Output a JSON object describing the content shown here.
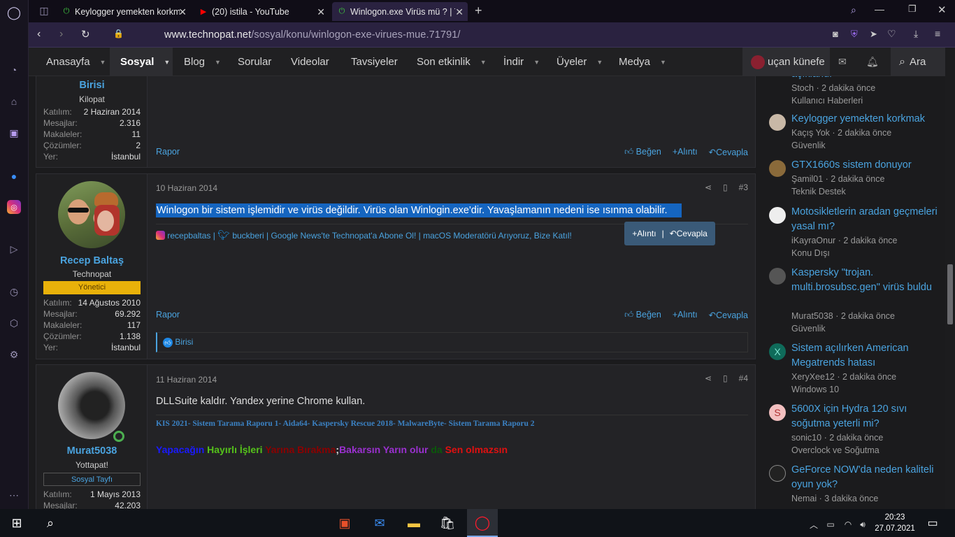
{
  "browser": {
    "tabs": [
      {
        "title": "Keylogger yemekten korkm"
      },
      {
        "title": "(20) istila - YouTube"
      },
      {
        "title": "Winlogon.exe Virüs mü ? | T"
      }
    ],
    "url_host": "www.technopat.net",
    "url_path": "/sosyal/konu/winlogon-exe-virues-mue.71791/"
  },
  "nav": {
    "items": [
      "Anasayfa",
      "Sosyal",
      "Blog",
      "Sorular",
      "Videolar",
      "Tavsiyeler",
      "Son etkinlik",
      "İndir",
      "Üyeler",
      "Medya"
    ],
    "username": "uçan künefe",
    "search": "Ara"
  },
  "post1": {
    "username": "Birisi",
    "user_title": "Kilopat",
    "stats": [
      {
        "k": "Katılım:",
        "v": "2 Haziran 2014"
      },
      {
        "k": "Mesajlar:",
        "v": "2.316"
      },
      {
        "k": "Makaleler:",
        "v": "11"
      },
      {
        "k": "Çözümler:",
        "v": "2"
      },
      {
        "k": "Yer:",
        "v": "İstanbul"
      }
    ],
    "report": "Rapor",
    "like": "Beğen",
    "quote": "Alıntı",
    "reply": "Cevapla"
  },
  "post2": {
    "username": "Recep Baltaş",
    "user_title": "Technopat",
    "badge": "Yönetici",
    "stats": [
      {
        "k": "Katılım:",
        "v": "14 Ağustos 2010"
      },
      {
        "k": "Mesajlar:",
        "v": "69.292"
      },
      {
        "k": "Makaleler:",
        "v": "117"
      },
      {
        "k": "Çözümler:",
        "v": "1.138"
      },
      {
        "k": "Yer:",
        "v": "İstanbul"
      }
    ],
    "date": "10 Haziran 2014",
    "number": "#3",
    "text": "Winlogon bir sistem işlemidir ve virüs değildir. Virüs olan Winlogin.exe'dir. Yavaşlamanın nedeni ise ısınma olabilir.",
    "sig_instagram": "recepbaltas",
    "sig_twitter": "buckberi",
    "sig_rest": "Google News'te Technopat'a Abone Ol! | macOS Moderatörü Arıyoruz, Bize Katıl!",
    "popup_quote": "Alıntı",
    "popup_reply": "Cevapla",
    "report": "Rapor",
    "like": "Beğen",
    "quote": "Alıntı",
    "reply": "Cevapla",
    "liked_by": "Birisi"
  },
  "post3": {
    "username": "Murat5038",
    "user_title": "Yottapat!",
    "badge": "Sosyal Tayfı",
    "stats": [
      {
        "k": "Katılım:",
        "v": "1 Mayıs 2013"
      },
      {
        "k": "Mesajlar:",
        "v": "42.203"
      }
    ],
    "date": "11 Haziran 2014",
    "number": "#4",
    "text": "DLLSuite kaldır. Yandex yerine Chrome kullan.",
    "sig_line": "KIS 2021- Sistem Tarama Raporu 1- Aida64- Kaspersky Rescue 2018- MalwareByte- Sistem Tarama Raporu 2",
    "sig_words": [
      {
        "t": "Yapacağın",
        "c": "#1a1aff"
      },
      {
        "t": "Hayırlı",
        "c": "#55c21a"
      },
      {
        "t": "İşleri",
        "c": "#55c21a"
      },
      {
        "t": "Yarına",
        "c": "#8b0000"
      },
      {
        "t": "Bırakma",
        "c": "#8b0000"
      },
      {
        "t": ";",
        "c": "#ddd"
      },
      {
        "t": "Bakarsın",
        "c": "#9b30d0"
      },
      {
        "t": "Yarın",
        "c": "#9b30d0"
      },
      {
        "t": "olur",
        "c": "#9b30d0"
      },
      {
        "t": "da",
        "c": "#0a5a0a"
      },
      {
        "t": "Sen",
        "c": "#e01010"
      },
      {
        "t": "olmazsın",
        "c": "#e01010"
      }
    ]
  },
  "sidebar_right": {
    "items": [
      {
        "title": "açıklandı",
        "user": "Stoch",
        "time": "2 dakika önce",
        "forum": "Kullanıcı Haberleri",
        "av": "",
        "avc": "#555"
      },
      {
        "title": "Keylogger yemekten korkmak",
        "user": "Kaçış Yok",
        "time": "2 dakika önce",
        "forum": "Güvenlik",
        "av": "",
        "avc": "#c8b8a6"
      },
      {
        "title": "GTX1660s sistem donuyor",
        "user": "Şamil01",
        "time": "2 dakika önce",
        "forum": "Teknik Destek",
        "av": "",
        "avc": "#8a6a3a"
      },
      {
        "title": "Motosikletlerin aradan geçmeleri yasal mı?",
        "user": "iKayraOnur",
        "time": "2 dakika önce",
        "forum": "Konu Dışı",
        "av": "",
        "avc": "#eee"
      },
      {
        "title": "Kaspersky \"trojan. multi.brosubsc.gen\" virüs buldu",
        "user": "Murat5038",
        "time": "2 dakika önce",
        "forum": "Güvenlik",
        "av": "",
        "avc": "#444"
      },
      {
        "title": "Sistem açılırken American Megatrends hatası",
        "user": "XeryXee12",
        "time": "2 dakika önce",
        "forum": "Windows 10",
        "av": "X",
        "avc": "#0f6b5a"
      },
      {
        "title": "5600X için Hydra 120 sıvı soğutma yeterli mi?",
        "user": "sonic10",
        "time": "2 dakika önce",
        "forum": "Overclock ve Soğutma",
        "av": "S",
        "avc": "#f3c0c0"
      },
      {
        "title": "GeForce NOW'da neden kaliteli oyun yok?",
        "user": "Nemai",
        "time": "3 dakika önce",
        "forum": "",
        "av": "",
        "avc": "#222"
      }
    ]
  },
  "taskbar": {
    "time": "20:23",
    "date": "27.07.2021"
  }
}
